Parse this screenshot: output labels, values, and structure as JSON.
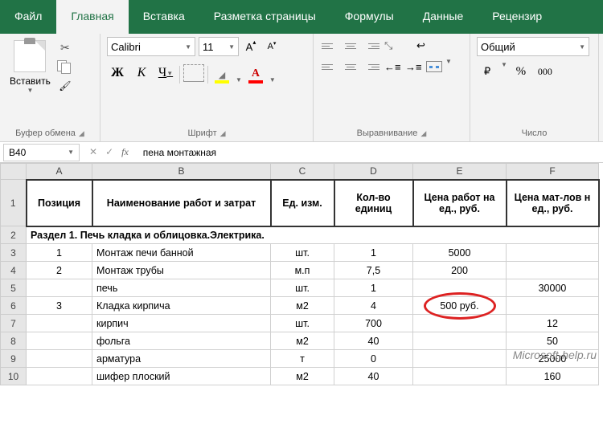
{
  "tabs": {
    "file": "Файл",
    "home": "Главная",
    "insert": "Вставка",
    "layout": "Разметка страницы",
    "formulas": "Формулы",
    "data": "Данные",
    "review": "Рецензир"
  },
  "ribbon": {
    "paste": "Вставить",
    "clipboard_group": "Буфер обмена",
    "font_name": "Calibri",
    "font_size": "11",
    "font_group": "Шрифт",
    "bold": "Ж",
    "italic": "К",
    "underline": "Ч",
    "align_group": "Выравнивание",
    "number_format": "Общий",
    "number_group": "Число",
    "pct": "%",
    "sep": "000"
  },
  "fbar": {
    "cell_ref": "B40",
    "value": "пена монтажная"
  },
  "cols": [
    "A",
    "B",
    "C",
    "D",
    "E",
    "F"
  ],
  "headers": {
    "pos": "Позиция",
    "name": "Наименование работ и затрат",
    "unit": "Ед. изм.",
    "qty": "Кол-во единиц",
    "price_work": "Цена работ на ед., руб.",
    "price_mat": "Цена мат-лов н ед., руб."
  },
  "section": "Раздел 1. Печь кладка и облицовка.Электрика.",
  "rows": [
    {
      "n": "3",
      "pos": "1",
      "name": "Монтаж печи банной",
      "unit": "шт.",
      "qty": "1",
      "pw": "5000",
      "pm": ""
    },
    {
      "n": "4",
      "pos": "2",
      "name": "Монтаж трубы",
      "unit": "м.п",
      "qty": "7,5",
      "pw": "200",
      "pm": ""
    },
    {
      "n": "5",
      "pos": "",
      "name": "печь",
      "unit": "шт.",
      "qty": "1",
      "pw": "",
      "pm": "30000"
    },
    {
      "n": "6",
      "pos": "3",
      "name": "Кладка кирпича",
      "unit": "м2",
      "qty": "4",
      "pw": "500 руб.",
      "pm": ""
    },
    {
      "n": "7",
      "pos": "",
      "name": "кирпич",
      "unit": "шт.",
      "qty": "700",
      "pw": "",
      "pm": "12"
    },
    {
      "n": "8",
      "pos": "",
      "name": "фольга",
      "unit": "м2",
      "qty": "40",
      "pw": "",
      "pm": "50"
    },
    {
      "n": "9",
      "pos": "",
      "name": "арматура",
      "unit": "т",
      "qty": "0",
      "pw": "",
      "pm": "25000"
    },
    {
      "n": "10",
      "pos": "",
      "name": "шифер плоский",
      "unit": "м2",
      "qty": "40",
      "pw": "",
      "pm": "160"
    }
  ],
  "watermark": "Microsoft-help.ru"
}
